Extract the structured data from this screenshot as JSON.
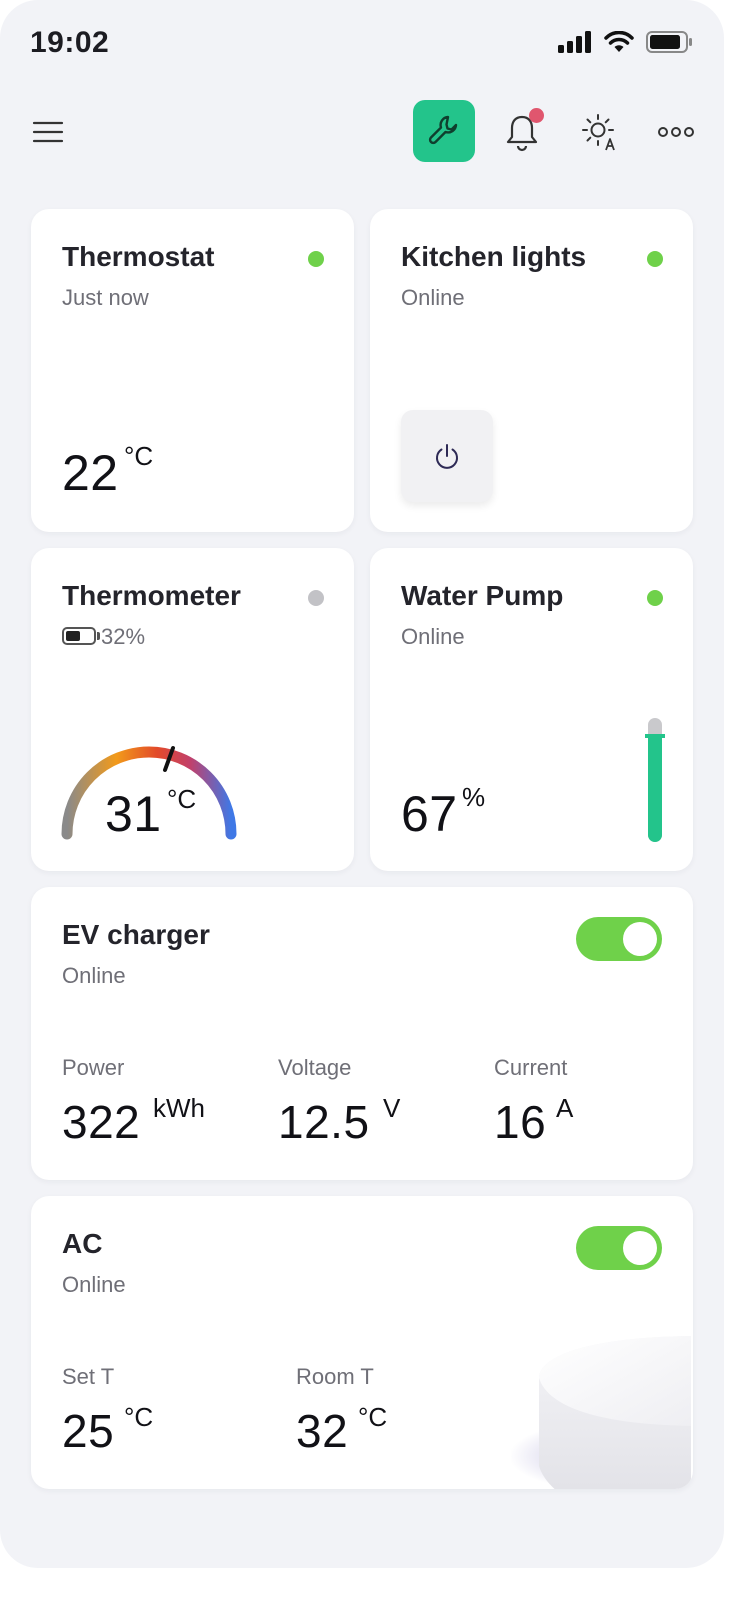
{
  "status_bar": {
    "time": "19:02"
  },
  "topbar": {
    "icons": [
      "menu-icon",
      "wrench-icon",
      "bell-icon",
      "brightness-auto-icon",
      "more-icon"
    ],
    "has_notification": true
  },
  "colors": {
    "accent": "#23c48b",
    "online": "#6fd14a",
    "offline": "#c2c2c6",
    "notification": "#e0566e"
  },
  "thermostat": {
    "title": "Thermostat",
    "subtitle": "Just now",
    "value": "22",
    "unit": "°C",
    "status": "online"
  },
  "kitchen_lights": {
    "title": "Kitchen lights",
    "subtitle": "Online",
    "status": "online"
  },
  "thermometer": {
    "title": "Thermometer",
    "battery": "32%",
    "battery_level": 0.32,
    "value": "31",
    "unit": "°C",
    "status": "offline"
  },
  "water_pump": {
    "title": "Water Pump",
    "subtitle": "Online",
    "value": "67",
    "unit": "%",
    "level": 0.67,
    "status": "online"
  },
  "ev_charger": {
    "title": "EV charger",
    "subtitle": "Online",
    "enabled": true,
    "metrics": [
      {
        "label": "Power",
        "value": "322",
        "unit": "kWh"
      },
      {
        "label": "Voltage",
        "value": "12.5",
        "unit": "V"
      },
      {
        "label": "Current",
        "value": "16",
        "unit": "A"
      }
    ]
  },
  "ac": {
    "title": "AC",
    "subtitle": "Online",
    "enabled": true,
    "metrics": [
      {
        "label": "Set T",
        "value": "25",
        "unit": "°C"
      },
      {
        "label": "Room T",
        "value": "32",
        "unit": "°C"
      }
    ]
  }
}
